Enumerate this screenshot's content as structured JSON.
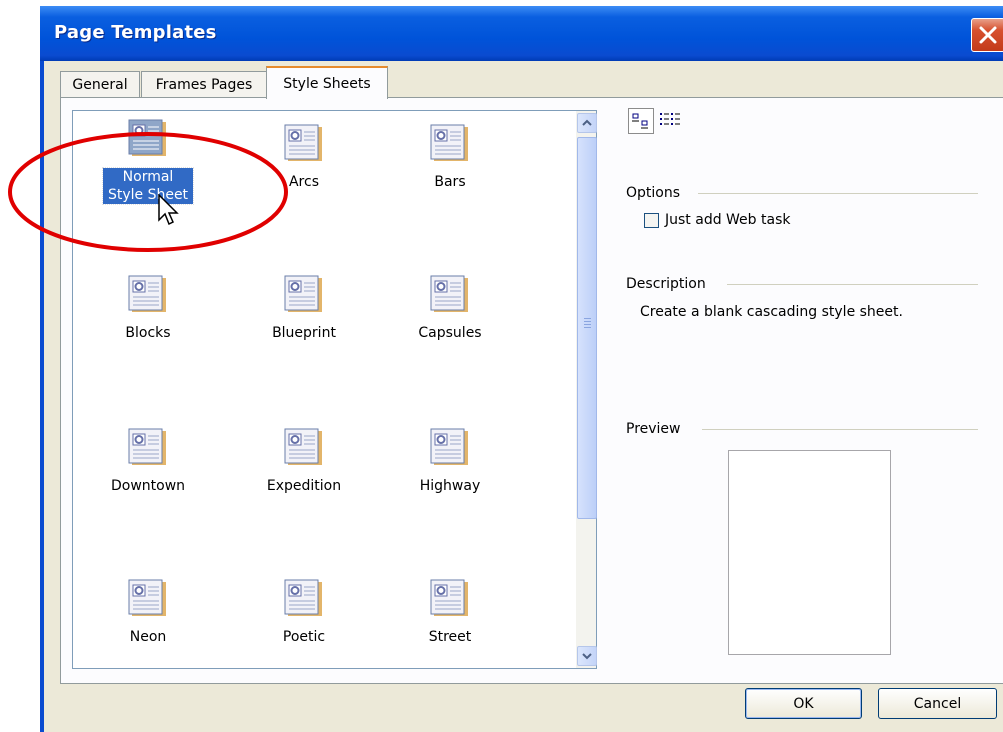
{
  "window": {
    "title": "Page Templates",
    "close_icon": "close-icon"
  },
  "tabs": [
    {
      "label": "General"
    },
    {
      "label": "Frames Pages"
    },
    {
      "label": "Style Sheets"
    }
  ],
  "active_tab": "Style Sheets",
  "templates": [
    {
      "label": "Normal Style Sheet",
      "selected": true
    },
    {
      "label": "Arcs"
    },
    {
      "label": "Bars"
    },
    {
      "label": "Blocks"
    },
    {
      "label": "Blueprint"
    },
    {
      "label": "Capsules"
    },
    {
      "label": "Downtown"
    },
    {
      "label": "Expedition"
    },
    {
      "label": "Highway"
    },
    {
      "label": "Neon"
    },
    {
      "label": "Poetic"
    },
    {
      "label": "Street"
    }
  ],
  "view_buttons": {
    "large_icons": "large-icons-view-icon",
    "details": "details-view-icon"
  },
  "options": {
    "label": "Options",
    "checkbox_label": "Just add Web task",
    "checked": false
  },
  "description": {
    "label": "Description",
    "text": "Create a blank cascading style sheet."
  },
  "preview": {
    "label": "Preview"
  },
  "buttons": {
    "ok": "OK",
    "cancel": "Cancel"
  },
  "colors": {
    "title_bar": "#0053d9",
    "selection": "#316ac5",
    "annotation": "#e00000"
  }
}
